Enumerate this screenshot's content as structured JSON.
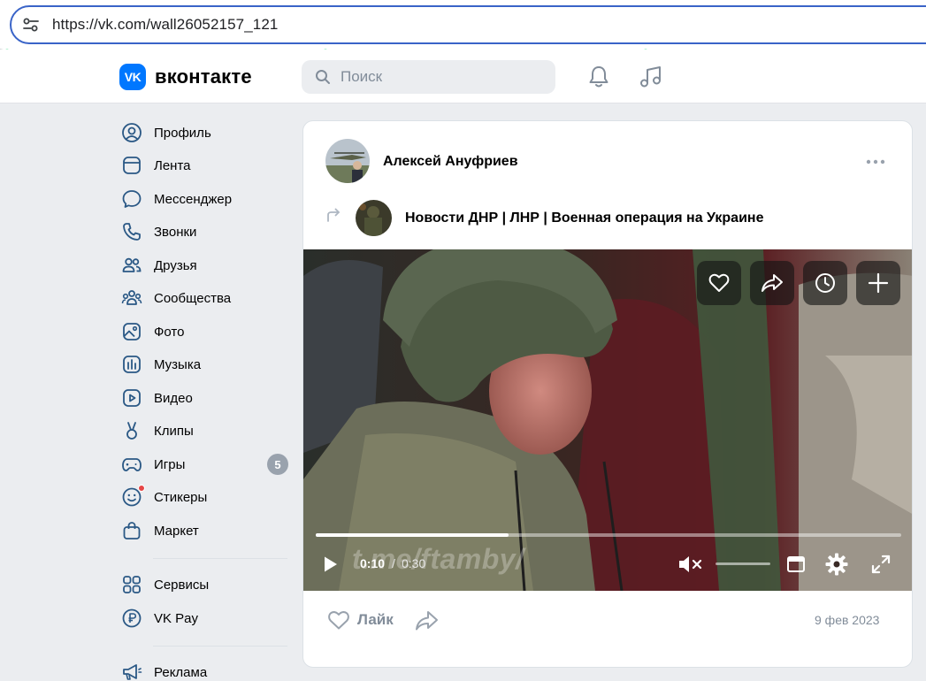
{
  "browser": {
    "url": "https://vk.com/wall26052157_121",
    "settings_icon": "site-settings-icon"
  },
  "header": {
    "logo_mark": "VK",
    "logo_text": "вконтакте",
    "search_placeholder": "Поиск",
    "icons": [
      "bell-icon",
      "music-icon"
    ]
  },
  "sidebar": {
    "items": [
      {
        "label": "Профиль",
        "icon": "profile-icon"
      },
      {
        "label": "Лента",
        "icon": "feed-icon"
      },
      {
        "label": "Мессенджер",
        "icon": "messenger-icon"
      },
      {
        "label": "Звонки",
        "icon": "phone-icon"
      },
      {
        "label": "Друзья",
        "icon": "friends-icon"
      },
      {
        "label": "Сообщества",
        "icon": "communities-icon"
      },
      {
        "label": "Фото",
        "icon": "photo-icon"
      },
      {
        "label": "Музыка",
        "icon": "music-icon"
      },
      {
        "label": "Видео",
        "icon": "video-icon"
      },
      {
        "label": "Клипы",
        "icon": "clips-icon"
      },
      {
        "label": "Игры",
        "icon": "games-icon",
        "badge": "5"
      },
      {
        "label": "Стикеры",
        "icon": "stickers-icon"
      },
      {
        "label": "Маркет",
        "icon": "market-icon"
      },
      {
        "label": "Сервисы",
        "icon": "services-icon"
      },
      {
        "label": "VK Pay",
        "icon": "vkpay-icon"
      },
      {
        "label": "Реклама",
        "icon": "ads-icon"
      }
    ]
  },
  "post": {
    "author": "Алексей Ануфриев",
    "source": "Новости ДНР | ЛНР | Военная операция на Украине",
    "video": {
      "current_time": "0:10",
      "separator": "/",
      "total_time": "0:30",
      "progress": 0.33,
      "volume": 0,
      "muted": true,
      "watermark": "t.me/ftamby/"
    },
    "like_label": "Лайк",
    "date": "9 фев 2023"
  },
  "colors": {
    "accent": "#0077ff",
    "url_border": "#3a64c8",
    "muted_text": "#818c99",
    "sidebar_icon": "#2a5885",
    "page_bg": "#ebedf0"
  }
}
